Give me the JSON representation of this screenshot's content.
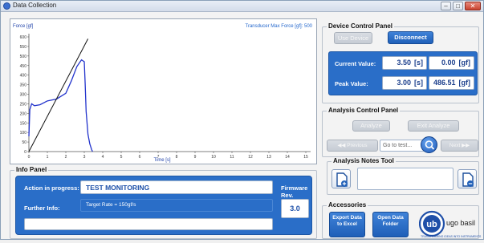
{
  "window": {
    "title": "Data Collection"
  },
  "chart": {
    "y_label": "Force [gf]",
    "max_force_label": "Transducer Max Force [gf]: 500",
    "x_label": "Time [s]",
    "y_ticks": [
      "600",
      "550",
      "500",
      "450",
      "400",
      "350",
      "300",
      "250",
      "200",
      "150",
      "100",
      "50",
      "0"
    ],
    "x_ticks": [
      "0",
      "1",
      "2",
      "3",
      "4",
      "5",
      "6",
      "7",
      "8",
      "9",
      "10",
      "11",
      "12",
      "13",
      "14",
      "15"
    ]
  },
  "chart_data": {
    "type": "line",
    "title": "",
    "xlabel": "Time [s]",
    "ylabel": "Force [gf]",
    "xlim": [
      0,
      15
    ],
    "ylim": [
      0,
      600
    ],
    "series": [
      {
        "color": "#2233cc",
        "x": [
          0,
          0.05,
          0.15,
          0.3,
          0.6,
          1.0,
          1.5,
          2.0,
          2.3,
          2.6,
          2.85,
          3.0,
          3.05,
          3.1,
          3.2,
          3.3,
          3.4,
          3.45
        ],
        "y": [
          80,
          220,
          250,
          240,
          245,
          265,
          275,
          305,
          370,
          445,
          480,
          470,
          350,
          210,
          90,
          40,
          10,
          0
        ]
      },
      {
        "color": "#111111",
        "x": [
          0,
          3.2
        ],
        "y": [
          0,
          590
        ]
      }
    ]
  },
  "device_panel": {
    "title": "Device Control Panel",
    "use_device": "Use Device",
    "disconnect": "Disconnect",
    "current_label": "Current Value:",
    "current_time": "3.50",
    "current_time_unit": "[s]",
    "current_force": "0.00",
    "current_force_unit": "[gf]",
    "peak_label": "Peak Value:",
    "peak_time": "3.00",
    "peak_time_unit": "[s]",
    "peak_force": "486.51",
    "peak_force_unit": "[gf]"
  },
  "analysis_panel": {
    "title": "Analysis Control Panel",
    "analyze": "Analyze",
    "exit_analyze": "Exit Analyze",
    "previous": "Previous",
    "go_to_placeholder": "Go to test...",
    "next": "Next"
  },
  "notes_panel": {
    "title": "Analysis Notes Tool"
  },
  "accessories": {
    "title": "Accessories",
    "export": "Export Data to Excel",
    "open": "Open Data Folder",
    "brand": "ugo basil",
    "brand_tagline": "TRANSFORMING IDEAS INTO INSTRUMENTS"
  },
  "info_panel": {
    "title": "Info Panel",
    "action_label": "Action in progress:",
    "action_value": "TEST MONITORING",
    "firmware_label": "Firmware Rev.",
    "firmware_value": "3.0",
    "further_label": "Further Info:",
    "further_value": "Target Rate = 150gf/s"
  }
}
